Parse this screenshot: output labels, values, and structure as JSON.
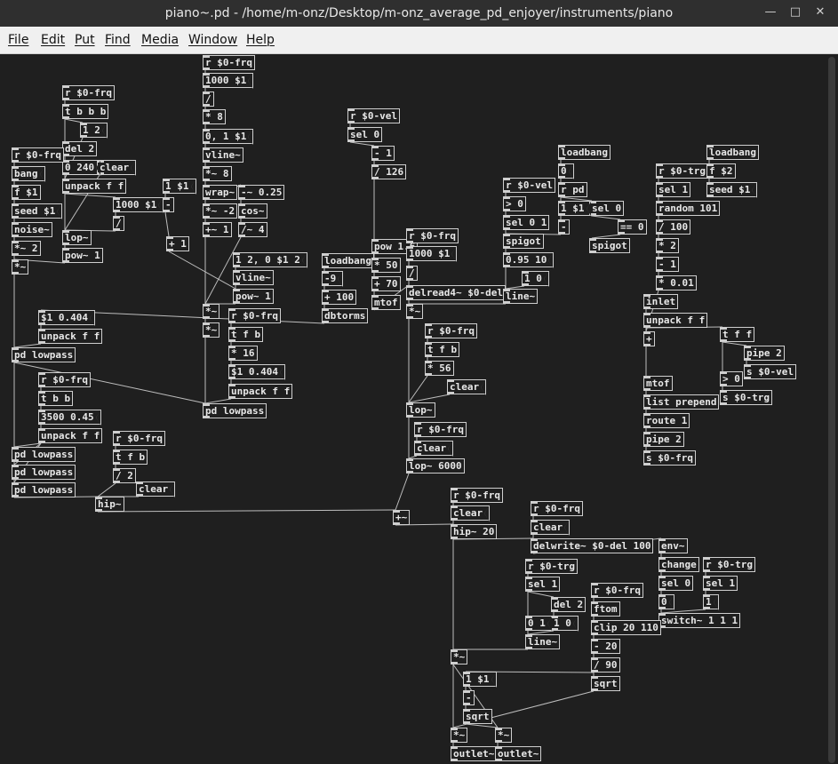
{
  "window": {
    "title": "piano~.pd  - /home/m-onz/Desktop/m-onz_average_pd_enjoyer/instruments/piano",
    "minimize_glyph": "—",
    "maximize_glyph": "□",
    "close_glyph": "✕"
  },
  "menu": [
    "File",
    "Edit",
    "Put",
    "Find",
    "Media",
    "Window",
    "Help"
  ],
  "colors": {
    "canvas": "#1f1f1f",
    "box_border": "#cfcfcf",
    "text": "#e8e8e8",
    "wire": "#bdbdbd",
    "menubar": "#f0f0f0",
    "titlebar": "#2f2f2f"
  },
  "objects": [
    {
      "id": "o1",
      "text": "r $0-frq",
      "kind": "obj"
    },
    {
      "id": "o2",
      "text": "1000 $1",
      "kind": "msg"
    },
    {
      "id": "o3",
      "text": "/",
      "kind": "obj"
    },
    {
      "id": "o4",
      "text": "* 8",
      "kind": "obj"
    },
    {
      "id": "o5",
      "text": "0, 1 $1",
      "kind": "msg"
    },
    {
      "id": "o6",
      "text": "vline~",
      "kind": "obj"
    },
    {
      "id": "o7",
      "text": "*~ 8",
      "kind": "obj"
    },
    {
      "id": "o8",
      "text": "wrap~",
      "kind": "obj"
    },
    {
      "id": "o9",
      "text": "-~ 0.25",
      "kind": "obj"
    },
    {
      "id": "o10",
      "text": "*~ -2",
      "kind": "obj"
    },
    {
      "id": "o11",
      "text": "cos~",
      "kind": "obj"
    },
    {
      "id": "o12",
      "text": "+~ 1",
      "kind": "obj"
    },
    {
      "id": "o13",
      "text": "/~ 4",
      "kind": "obj"
    },
    {
      "id": "o14",
      "text": "r $0-frq",
      "kind": "obj"
    },
    {
      "id": "o15",
      "text": "t b b b",
      "kind": "obj"
    },
    {
      "id": "o16",
      "text": "1 2",
      "kind": "msg"
    },
    {
      "id": "o17",
      "text": "del 2",
      "kind": "obj"
    },
    {
      "id": "o18",
      "text": "0 240",
      "kind": "msg"
    },
    {
      "id": "o19",
      "text": "clear",
      "kind": "msg"
    },
    {
      "id": "o20",
      "text": "unpack f f",
      "kind": "obj"
    },
    {
      "id": "o21",
      "text": "1000 $1",
      "kind": "msg"
    },
    {
      "id": "o22",
      "text": "/",
      "kind": "obj"
    },
    {
      "id": "o23",
      "text": "r $0-frq",
      "kind": "obj"
    },
    {
      "id": "o24",
      "text": "bang",
      "kind": "msg"
    },
    {
      "id": "o25",
      "text": "f $1",
      "kind": "obj"
    },
    {
      "id": "o26",
      "text": "seed $1",
      "kind": "msg"
    },
    {
      "id": "o27",
      "text": "noise~",
      "kind": "obj"
    },
    {
      "id": "o28",
      "text": "*~ 2",
      "kind": "obj"
    },
    {
      "id": "o29",
      "text": "*~",
      "kind": "obj"
    },
    {
      "id": "o30",
      "text": "lop~",
      "kind": "obj"
    },
    {
      "id": "o31",
      "text": "pow~ 1",
      "kind": "obj"
    },
    {
      "id": "o32",
      "text": "1 $1",
      "kind": "msg"
    },
    {
      "id": "o33",
      "text": "-",
      "kind": "obj"
    },
    {
      "id": "o34",
      "text": "+ 1",
      "kind": "obj"
    },
    {
      "id": "o35",
      "text": "1 2, 0 $1 2",
      "kind": "msg"
    },
    {
      "id": "o36",
      "text": "vline~",
      "kind": "obj"
    },
    {
      "id": "o37",
      "text": "pow~ 1",
      "kind": "obj"
    },
    {
      "id": "o38",
      "text": "*~",
      "kind": "obj"
    },
    {
      "id": "o39",
      "text": "r $0-frq",
      "kind": "obj"
    },
    {
      "id": "o40",
      "text": "*~",
      "kind": "obj"
    },
    {
      "id": "o41",
      "text": "t f b",
      "kind": "obj"
    },
    {
      "id": "o42",
      "text": "* 16",
      "kind": "obj"
    },
    {
      "id": "o43",
      "text": "$1 0.404",
      "kind": "msg"
    },
    {
      "id": "o44",
      "text": "unpack f f",
      "kind": "obj"
    },
    {
      "id": "o45",
      "text": "pd lowpass",
      "kind": "obj"
    },
    {
      "id": "o46",
      "text": "$1 0.404",
      "kind": "msg"
    },
    {
      "id": "o47",
      "text": "unpack f f",
      "kind": "obj"
    },
    {
      "id": "o48",
      "text": "pd lowpass",
      "kind": "obj"
    },
    {
      "id": "o49",
      "text": "r $0-frq",
      "kind": "obj"
    },
    {
      "id": "o50",
      "text": "t b b",
      "kind": "obj"
    },
    {
      "id": "o51",
      "text": "3500 0.45",
      "kind": "msg"
    },
    {
      "id": "o52",
      "text": "unpack f f",
      "kind": "obj"
    },
    {
      "id": "o53",
      "text": "pd lowpass",
      "kind": "obj"
    },
    {
      "id": "o54",
      "text": "pd lowpass",
      "kind": "obj"
    },
    {
      "id": "o55",
      "text": "pd lowpass",
      "kind": "obj"
    },
    {
      "id": "o56",
      "text": "r $0-frq",
      "kind": "obj"
    },
    {
      "id": "o57",
      "text": "t f b",
      "kind": "obj"
    },
    {
      "id": "o58",
      "text": "/ 2",
      "kind": "obj"
    },
    {
      "id": "o59",
      "text": "clear",
      "kind": "msg"
    },
    {
      "id": "o60",
      "text": "hip~",
      "kind": "obj"
    },
    {
      "id": "o61",
      "text": "r $0-vel",
      "kind": "obj"
    },
    {
      "id": "o62",
      "text": "sel 0",
      "kind": "obj"
    },
    {
      "id": "o63",
      "text": "- 1",
      "kind": "obj"
    },
    {
      "id": "o64",
      "text": "/ 126",
      "kind": "obj"
    },
    {
      "id": "o65",
      "text": "loadbang",
      "kind": "obj"
    },
    {
      "id": "o66",
      "text": "-9",
      "kind": "msg"
    },
    {
      "id": "o67",
      "text": "+ 100",
      "kind": "obj"
    },
    {
      "id": "o68",
      "text": "dbtorms",
      "kind": "obj"
    },
    {
      "id": "o69",
      "text": "pow 1.6",
      "kind": "obj"
    },
    {
      "id": "o70",
      "text": "* 50",
      "kind": "obj"
    },
    {
      "id": "o71",
      "text": "+ 70",
      "kind": "obj"
    },
    {
      "id": "o72",
      "text": "mtof",
      "kind": "obj"
    },
    {
      "id": "o73",
      "text": "r $0-frq",
      "kind": "obj"
    },
    {
      "id": "o74",
      "text": "1000 $1",
      "kind": "msg"
    },
    {
      "id": "o75",
      "text": "/",
      "kind": "obj"
    },
    {
      "id": "o76",
      "text": "delread4~ $0-del",
      "kind": "obj"
    },
    {
      "id": "o77",
      "text": "*~",
      "kind": "obj"
    },
    {
      "id": "o78",
      "text": "r $0-frq",
      "kind": "obj"
    },
    {
      "id": "o79",
      "text": "t f b",
      "kind": "obj"
    },
    {
      "id": "o80",
      "text": "* 56",
      "kind": "obj"
    },
    {
      "id": "o81",
      "text": "clear",
      "kind": "msg"
    },
    {
      "id": "o82",
      "text": "lop~",
      "kind": "obj"
    },
    {
      "id": "o83",
      "text": "r $0-frq",
      "kind": "obj"
    },
    {
      "id": "o84",
      "text": "clear",
      "kind": "msg"
    },
    {
      "id": "o85",
      "text": "lop~ 6000",
      "kind": "obj"
    },
    {
      "id": "o86",
      "text": "r $0-vel",
      "kind": "obj"
    },
    {
      "id": "o87",
      "text": "> 0",
      "kind": "obj"
    },
    {
      "id": "o88",
      "text": "sel 0 1",
      "kind": "obj"
    },
    {
      "id": "o89",
      "text": "spigot",
      "kind": "obj"
    },
    {
      "id": "o90",
      "text": "0.95 10",
      "kind": "msg"
    },
    {
      "id": "o91",
      "text": "1 0",
      "kind": "msg"
    },
    {
      "id": "o92",
      "text": "line~",
      "kind": "obj"
    },
    {
      "id": "o93",
      "text": "loadbang",
      "kind": "obj"
    },
    {
      "id": "o94",
      "text": "0",
      "kind": "msg"
    },
    {
      "id": "o95",
      "text": "r pd",
      "kind": "obj"
    },
    {
      "id": "o96",
      "text": "1 $1",
      "kind": "msg"
    },
    {
      "id": "o97",
      "text": "sel 0",
      "kind": "obj"
    },
    {
      "id": "o98",
      "text": "-",
      "kind": "obj"
    },
    {
      "id": "o99",
      "text": "== 0",
      "kind": "obj"
    },
    {
      "id": "o100",
      "text": "spigot",
      "kind": "obj"
    },
    {
      "id": "o101",
      "text": "r $0-trg",
      "kind": "obj"
    },
    {
      "id": "o102",
      "text": "sel 1",
      "kind": "obj"
    },
    {
      "id": "o103",
      "text": "random 101",
      "kind": "obj"
    },
    {
      "id": "o104",
      "text": "/ 100",
      "kind": "obj"
    },
    {
      "id": "o105",
      "text": "* 2",
      "kind": "obj"
    },
    {
      "id": "o106",
      "text": "- 1",
      "kind": "obj"
    },
    {
      "id": "o107",
      "text": "* 0.01",
      "kind": "obj"
    },
    {
      "id": "o108",
      "text": "loadbang",
      "kind": "obj"
    },
    {
      "id": "o109",
      "text": "f $2",
      "kind": "obj"
    },
    {
      "id": "o110",
      "text": "seed $1",
      "kind": "msg"
    },
    {
      "id": "o111",
      "text": "inlet",
      "kind": "obj"
    },
    {
      "id": "o112",
      "text": "unpack f f",
      "kind": "obj"
    },
    {
      "id": "o113",
      "text": "+",
      "kind": "obj"
    },
    {
      "id": "o114",
      "text": "t f f",
      "kind": "obj"
    },
    {
      "id": "o115",
      "text": "pipe 2",
      "kind": "obj"
    },
    {
      "id": "o116",
      "text": "s $0-vel",
      "kind": "obj"
    },
    {
      "id": "o117",
      "text": "> 0",
      "kind": "obj"
    },
    {
      "id": "o118",
      "text": "s $0-trg",
      "kind": "obj"
    },
    {
      "id": "o119",
      "text": "mtof",
      "kind": "obj"
    },
    {
      "id": "o120",
      "text": "list prepend",
      "kind": "obj"
    },
    {
      "id": "o121",
      "text": "route 1",
      "kind": "obj"
    },
    {
      "id": "o122",
      "text": "pipe 2",
      "kind": "obj"
    },
    {
      "id": "o123",
      "text": "s $0-frq",
      "kind": "obj"
    },
    {
      "id": "o124",
      "text": "+~",
      "kind": "obj"
    },
    {
      "id": "o125",
      "text": "r $0-frq",
      "kind": "obj"
    },
    {
      "id": "o126",
      "text": "clear",
      "kind": "msg"
    },
    {
      "id": "o127",
      "text": "hip~ 20",
      "kind": "obj"
    },
    {
      "id": "o128",
      "text": "r $0-frq",
      "kind": "obj"
    },
    {
      "id": "o129",
      "text": "clear",
      "kind": "msg"
    },
    {
      "id": "o130",
      "text": "delwrite~ $0-del 100",
      "kind": "obj"
    },
    {
      "id": "o131",
      "text": "env~",
      "kind": "obj"
    },
    {
      "id": "o132",
      "text": "change",
      "kind": "obj"
    },
    {
      "id": "o133",
      "text": "sel 0",
      "kind": "obj"
    },
    {
      "id": "o134",
      "text": "0",
      "kind": "msg"
    },
    {
      "id": "o135",
      "text": "r $0-trg",
      "kind": "obj"
    },
    {
      "id": "o136",
      "text": "sel 1",
      "kind": "obj"
    },
    {
      "id": "o137",
      "text": "1",
      "kind": "msg"
    },
    {
      "id": "o138",
      "text": "switch~ 1 1 1",
      "kind": "obj"
    },
    {
      "id": "o139",
      "text": "r $0-trg",
      "kind": "obj"
    },
    {
      "id": "o140",
      "text": "sel 1",
      "kind": "obj"
    },
    {
      "id": "o141",
      "text": "del 2",
      "kind": "obj"
    },
    {
      "id": "o142",
      "text": "0 1",
      "kind": "msg"
    },
    {
      "id": "o143",
      "text": "1 0",
      "kind": "msg"
    },
    {
      "id": "o144",
      "text": "line~",
      "kind": "obj"
    },
    {
      "id": "o145",
      "text": "r $0-frq",
      "kind": "obj"
    },
    {
      "id": "o146",
      "text": "ftom",
      "kind": "obj"
    },
    {
      "id": "o147",
      "text": "clip 20 110",
      "kind": "obj"
    },
    {
      "id": "o148",
      "text": "- 20",
      "kind": "obj"
    },
    {
      "id": "o149",
      "text": "/ 90",
      "kind": "obj"
    },
    {
      "id": "o150",
      "text": "sqrt",
      "kind": "obj"
    },
    {
      "id": "o151",
      "text": "*~",
      "kind": "obj"
    },
    {
      "id": "o152",
      "text": "1 $1",
      "kind": "msg"
    },
    {
      "id": "o153",
      "text": "-",
      "kind": "obj"
    },
    {
      "id": "o154",
      "text": "sqrt",
      "kind": "obj"
    },
    {
      "id": "o155",
      "text": "*~",
      "kind": "obj"
    },
    {
      "id": "o156",
      "text": "*~",
      "kind": "obj"
    },
    {
      "id": "o157",
      "text": "outlet~",
      "kind": "obj"
    },
    {
      "id": "o158",
      "text": "outlet~",
      "kind": "obj"
    }
  ]
}
